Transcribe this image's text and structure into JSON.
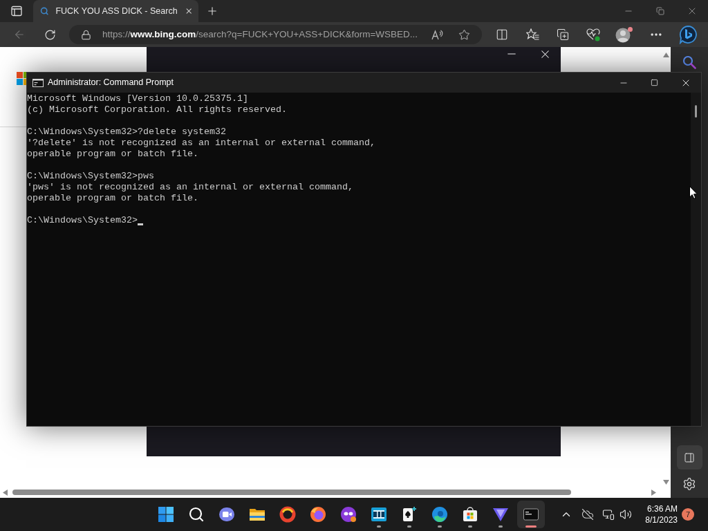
{
  "browser": {
    "tabs": [
      {
        "title": "FUCK YOU ASS DICK - Search",
        "selected": true
      }
    ],
    "back_button": {
      "disabled": true
    },
    "address_bar": {
      "url": "https://**www.bing.com**/search?q=FUCK+YOU+ASS+DICK&form=WSBED..."
    }
  },
  "command_prompt": {
    "title": "Administrator: Command Prompt",
    "blocks": [
      [
        "Microsoft Windows [Version 10.0.25375.1]",
        "(c) Microsoft Corporation. All rights reserved."
      ],
      [
        "C:\\Windows\\System32>?delete system32",
        "'?delete' is not recognized as an internal or external command,",
        "operable program or batch file."
      ],
      [
        "C:\\Windows\\System32>pws",
        "'pws' is not recognized as an internal or external command,",
        "operable program or batch file."
      ],
      [
        "C:\\Windows\\System32>"
      ]
    ],
    "cursor_visible": true
  },
  "taskbar": {
    "apps": [
      {
        "kind": "start",
        "running": false,
        "selected": false
      },
      {
        "kind": "search",
        "running": false,
        "selected": false
      },
      {
        "kind": "chat",
        "running": false,
        "selected": false
      },
      {
        "kind": "folder",
        "running": false,
        "selected": false
      },
      {
        "kind": "ring",
        "running": false,
        "selected": false
      },
      {
        "kind": "fox",
        "running": false,
        "selected": false
      },
      {
        "kind": "mask",
        "running": false,
        "selected": false
      },
      {
        "kind": "film",
        "running": true,
        "selected": false
      },
      {
        "kind": "cards",
        "running": true,
        "selected": false
      },
      {
        "kind": "swirl",
        "running": true,
        "selected": false
      },
      {
        "kind": "bag",
        "running": true,
        "selected": false
      },
      {
        "kind": "triangle",
        "running": true,
        "selected": false
      },
      {
        "kind": "terminal",
        "running": true,
        "selected": true
      }
    ],
    "clock": {
      "time": "6:36 AM",
      "date": "8/1/2023"
    },
    "notification_count": "7"
  }
}
